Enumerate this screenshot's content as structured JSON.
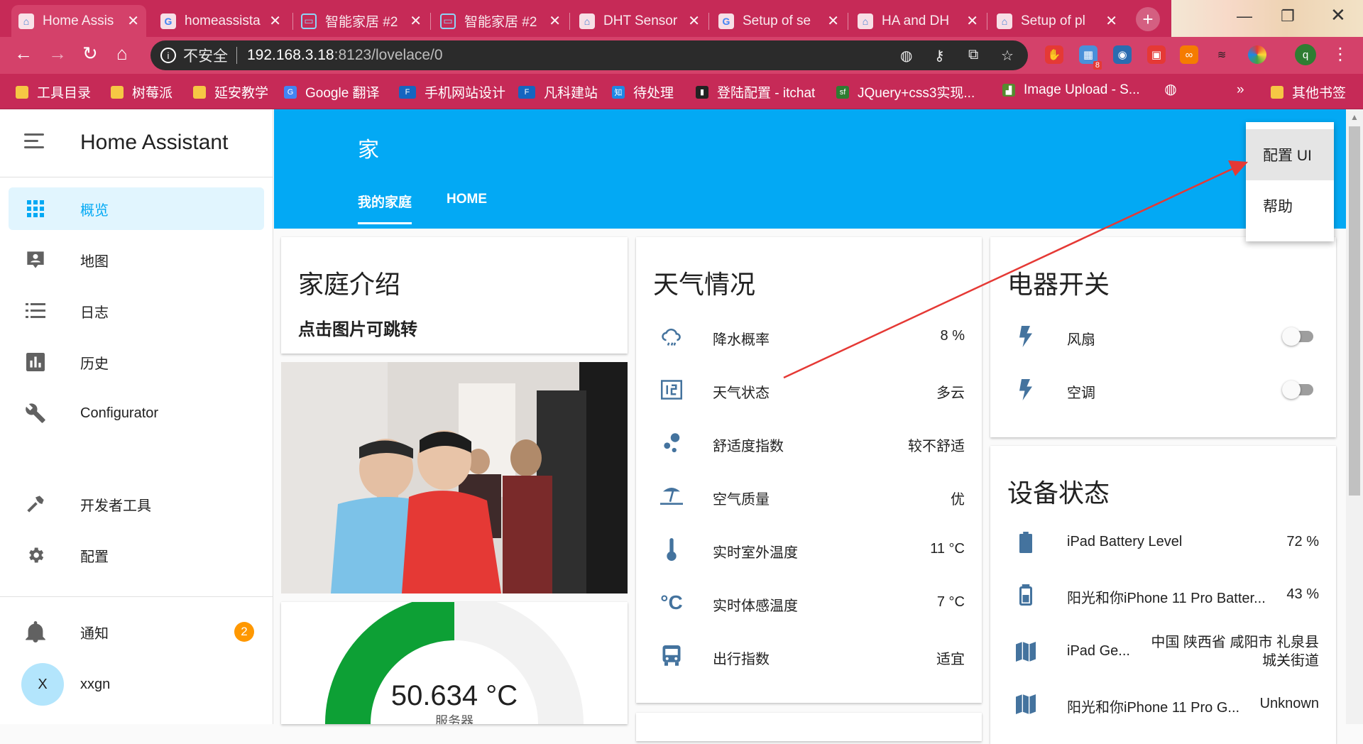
{
  "browser": {
    "tabs": [
      {
        "title": "Home Assis",
        "icon": "home-assistant-icon",
        "active": true
      },
      {
        "title": "homeassista",
        "icon": "google-icon"
      },
      {
        "title": "智能家居 #2",
        "icon": "bilibili-icon"
      },
      {
        "title": "智能家居 #2",
        "icon": "bilibili-icon"
      },
      {
        "title": "DHT Sensor",
        "icon": "home-assistant-icon"
      },
      {
        "title": "Setup of se",
        "icon": "google-icon"
      },
      {
        "title": "HA and DH",
        "icon": "home-assistant-icon"
      },
      {
        "title": "Setup of pl",
        "icon": "home-assistant-icon"
      }
    ],
    "insecure_label": "不安全",
    "url_host": "192.168.3.18",
    "url_path": ":8123/lovelace/0",
    "extension_badge": "8",
    "profile_initial": "q",
    "bookmarks": [
      {
        "label": "工具目录",
        "icon": "folder-icon"
      },
      {
        "label": "树莓派",
        "icon": "folder-icon"
      },
      {
        "label": "延安教学",
        "icon": "folder-icon"
      },
      {
        "label": "Google 翻译",
        "icon": "google-translate-icon"
      },
      {
        "label": "手机网站设计",
        "icon": "fkw-icon"
      },
      {
        "label": "凡科建站",
        "icon": "fkw-icon"
      },
      {
        "label": "待处理",
        "icon": "zhihu-icon"
      },
      {
        "label": "登陆配置 - itchat",
        "icon": "book-icon"
      },
      {
        "label": "JQuery+css3实现...",
        "icon": "sf-icon"
      },
      {
        "label": "Image Upload - S...",
        "icon": "chart-icon"
      },
      {
        "label": "",
        "icon": "globe-icon"
      }
    ],
    "more_bookmarks": "»",
    "other_bookmarks": "其他书签"
  },
  "sidebar": {
    "title": "Home Assistant",
    "items": [
      {
        "label": "概览",
        "icon": "grid-icon",
        "selected": true
      },
      {
        "label": "地图",
        "icon": "map-account-icon"
      },
      {
        "label": "日志",
        "icon": "list-icon"
      },
      {
        "label": "历史",
        "icon": "bar-chart-icon"
      },
      {
        "label": "Configurator",
        "icon": "wrench-icon"
      }
    ],
    "tools": [
      {
        "label": "开发者工具",
        "icon": "hammer-icon"
      },
      {
        "label": "配置",
        "icon": "gear-icon"
      }
    ],
    "notifications": {
      "label": "通知",
      "count": "2"
    },
    "user": {
      "initial": "X",
      "name": "xxgn"
    }
  },
  "header": {
    "title": "家",
    "tabs": [
      "我的家庭",
      "HOME"
    ]
  },
  "menu": {
    "items": [
      "配置 UI",
      "帮助"
    ]
  },
  "cards": {
    "intro": {
      "title": "家庭介绍",
      "subtitle": "点击图片可跳转"
    },
    "gauge": {
      "value": "50.634 °C",
      "label": "服务器",
      "fraction": 0.5
    },
    "weather": {
      "title": "天气情况",
      "rows": [
        {
          "label": "降水概率",
          "value": "8 %",
          "icon": "weather-pouring-icon"
        },
        {
          "label": "天气状态",
          "value": "多云",
          "icon": "calendar-number-icon"
        },
        {
          "label": "舒适度指数",
          "value": "较不舒适",
          "icon": "dots-icon"
        },
        {
          "label": "空气质量",
          "value": "优",
          "icon": "beach-icon"
        },
        {
          "label": "实时室外温度",
          "value": "11 °C",
          "icon": "thermometer-icon"
        },
        {
          "label": "实时体感温度",
          "value": "7 °C",
          "icon": "celsius-icon"
        },
        {
          "label": "出行指数",
          "value": "适宜",
          "icon": "bus-icon"
        }
      ]
    },
    "switches": {
      "title": "电器开关",
      "rows": [
        {
          "label": "风扇",
          "icon": "flash-icon",
          "on": false
        },
        {
          "label": "空调",
          "icon": "flash-icon",
          "on": false
        }
      ]
    },
    "devices": {
      "title": "设备状态",
      "rows": [
        {
          "label": "iPad Battery Level",
          "value": "72 %",
          "icon": "battery-icon"
        },
        {
          "label": "阳光和你iPhone 11 Pro Batter...",
          "value": "43 %",
          "icon": "battery-icon"
        },
        {
          "label": "iPad Ge...",
          "value": "中国 陕西省 咸阳市 礼泉县 城关街道",
          "icon": "map-icon"
        },
        {
          "label": "阳光和你iPhone 11 Pro G...",
          "value": "Unknown",
          "icon": "map-icon"
        }
      ]
    }
  },
  "colors": {
    "primary": "#03a9f4",
    "icon": "#44739e",
    "browser": "#c62a57",
    "badge": "#ff9800",
    "gauge": "#0da035"
  }
}
